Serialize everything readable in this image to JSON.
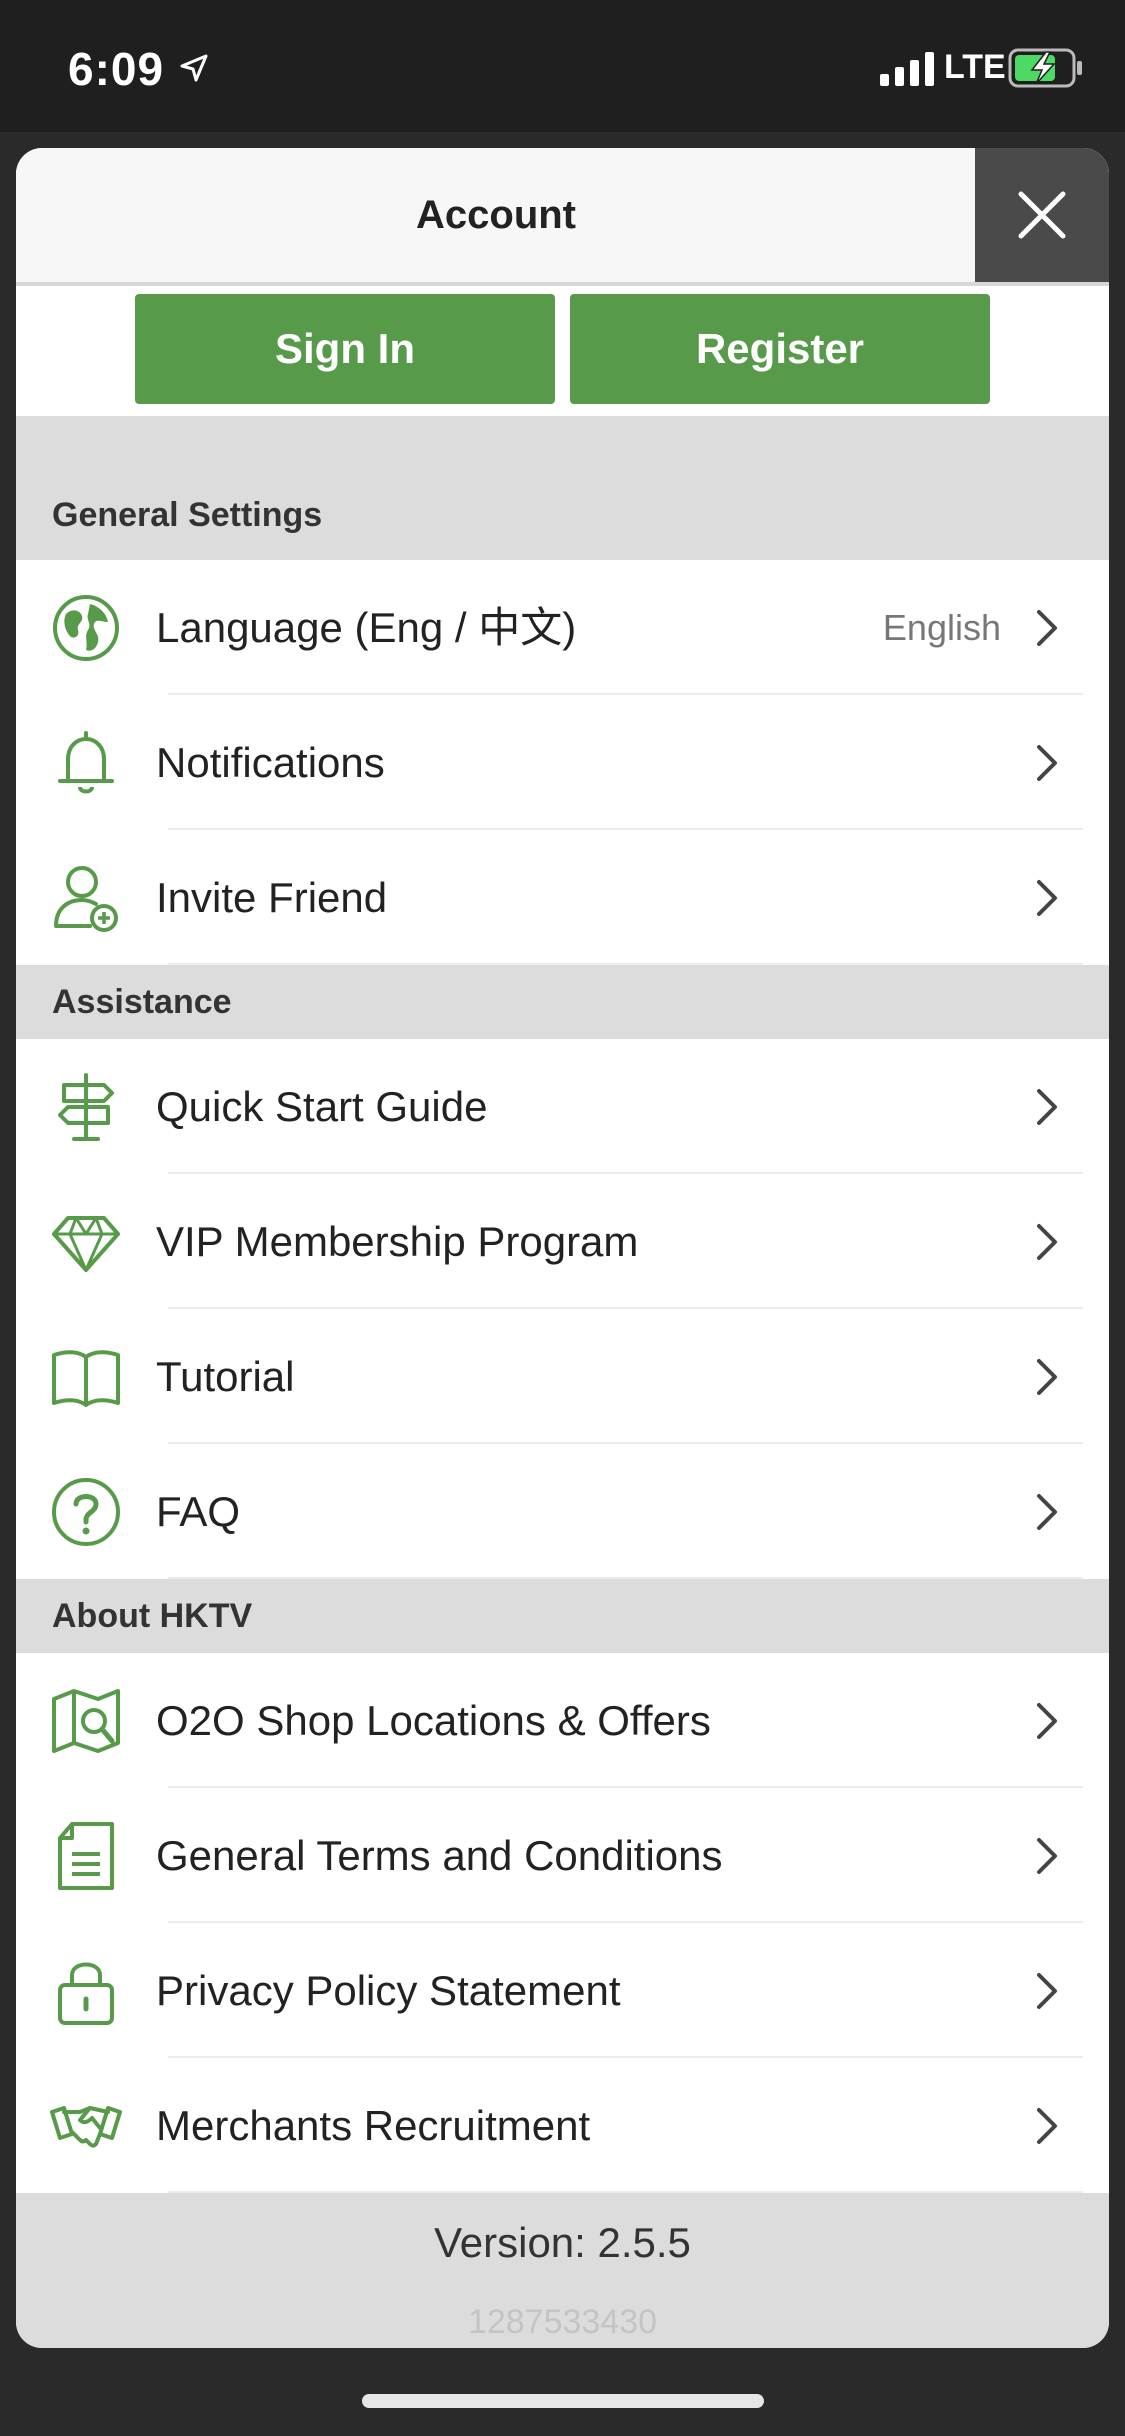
{
  "status_bar": {
    "time": "6:09",
    "network": "LTE"
  },
  "header": {
    "title": "Account"
  },
  "auth": {
    "sign_in": "Sign In",
    "register": "Register"
  },
  "colors": {
    "accent": "#579a4a",
    "section_bg": "#dcdcdc",
    "close_bg": "#4a4a4a"
  },
  "sections": {
    "general": {
      "title": "General Settings",
      "items": [
        {
          "label": "Language (Eng / 中文)",
          "value": "English",
          "icon": "globe-icon"
        },
        {
          "label": "Notifications",
          "icon": "bell-icon"
        },
        {
          "label": "Invite Friend",
          "icon": "add-user-icon"
        }
      ]
    },
    "assistance": {
      "title": "Assistance",
      "items": [
        {
          "label": "Quick Start Guide",
          "icon": "signpost-icon"
        },
        {
          "label": "VIP Membership Program",
          "icon": "diamond-icon"
        },
        {
          "label": "Tutorial",
          "icon": "book-icon"
        },
        {
          "label": "FAQ",
          "icon": "question-circle-icon"
        }
      ]
    },
    "about": {
      "title": "About HKTV",
      "items": [
        {
          "label": "O2O Shop Locations & Offers",
          "icon": "map-search-icon"
        },
        {
          "label": "General Terms and Conditions",
          "icon": "document-icon"
        },
        {
          "label": "Privacy Policy Statement",
          "icon": "lock-icon"
        },
        {
          "label": "Merchants Recruitment",
          "icon": "handshake-icon"
        }
      ]
    }
  },
  "footer": {
    "version": "Version: 2.5.5",
    "build_id": "1287533430"
  }
}
